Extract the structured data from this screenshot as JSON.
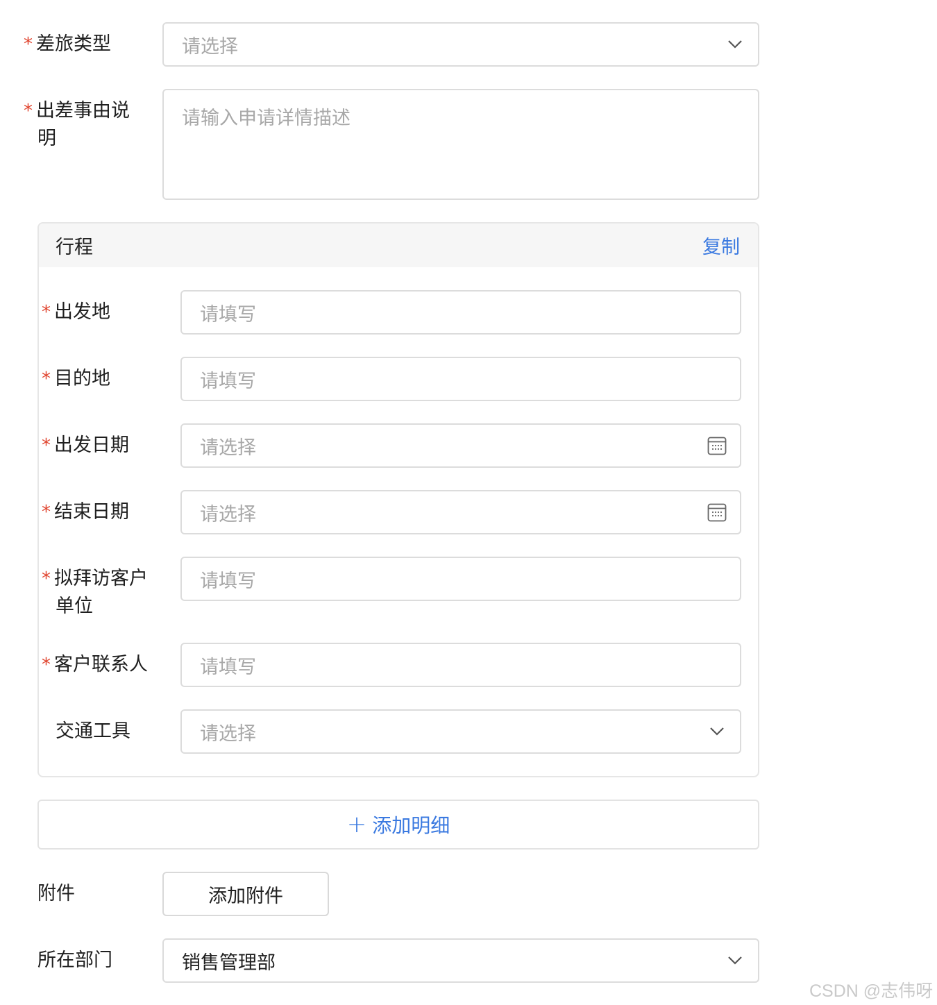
{
  "form": {
    "travel_type": {
      "label": "差旅类型",
      "placeholder": "请选择"
    },
    "reason": {
      "label": "出差事由说明",
      "placeholder": "请输入申请详情描述"
    },
    "itinerary": {
      "title": "行程",
      "copy_label": "复制",
      "departure": {
        "label": "出发地",
        "placeholder": "请填写"
      },
      "destination": {
        "label": "目的地",
        "placeholder": "请填写"
      },
      "start_date": {
        "label": "出发日期",
        "placeholder": "请选择"
      },
      "end_date": {
        "label": "结束日期",
        "placeholder": "请选择"
      },
      "client_unit": {
        "label": "拟拜访客户单位",
        "placeholder": "请填写"
      },
      "client_contact": {
        "label": "客户联系人",
        "placeholder": "请填写"
      },
      "transport": {
        "label": "交通工具",
        "placeholder": "请选择"
      }
    },
    "add_detail_label": "添加明细",
    "add_detail_plus": "+",
    "attachment": {
      "label": "附件",
      "button_label": "添加附件"
    },
    "department": {
      "label": "所在部门",
      "value": "销售管理部"
    },
    "required_mark": "*"
  },
  "watermark": "CSDN @志伟呀",
  "colors": {
    "accent": "#3a79e0",
    "required": "#e0452f",
    "border": "#dcdcdc",
    "placeholder": "#a8a8a8"
  },
  "icons": {
    "select": "chevron-down-icon",
    "date": "calendar-icon",
    "add": "plus-icon"
  }
}
